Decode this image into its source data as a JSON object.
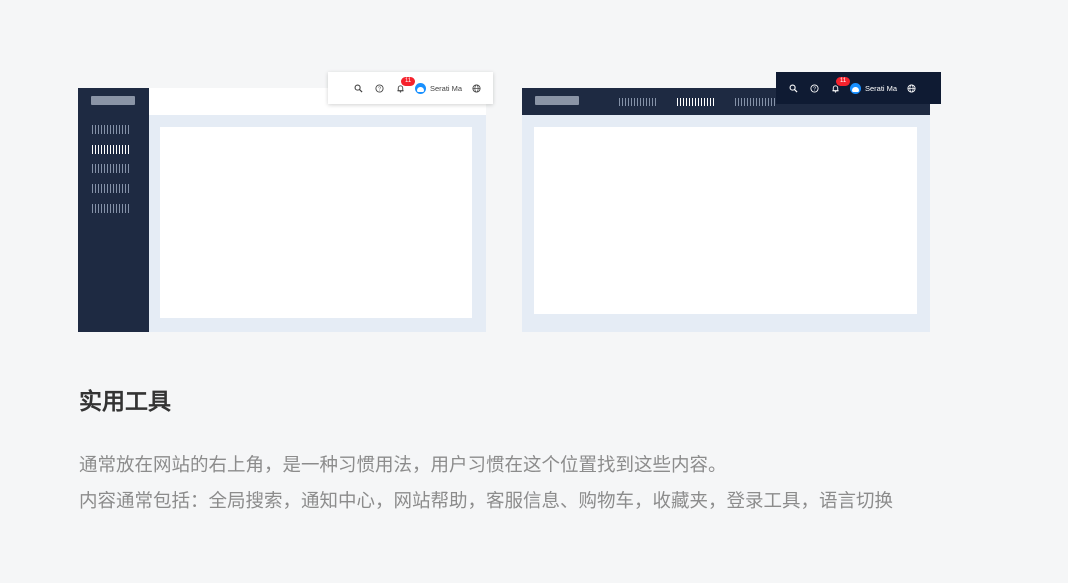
{
  "mockup_left": {
    "toolbar": {
      "icons": [
        "search-icon",
        "question-circle-icon",
        "bell-icon",
        "globe-icon"
      ],
      "badge_count": "11",
      "user_name": "Serati Ma"
    }
  },
  "mockup_right": {
    "toolbar": {
      "icons": [
        "search-icon",
        "question-circle-icon",
        "bell-icon",
        "globe-icon"
      ],
      "badge_count": "11",
      "user_name": "Serati Ma"
    }
  },
  "section": {
    "title": "实用工具",
    "description_line1": "通常放在网站的右上角，是一种习惯用法，用户习惯在这个位置找到这些内容。",
    "description_line2": "内容通常包括：全局搜索，通知中心，网站帮助，客服信息、购物车，收藏夹，登录工具，语言切换"
  },
  "colors": {
    "dark_nav": "#1e2a42",
    "dark_toolbar": "#0f1b33",
    "content_bg": "#e5ecf5",
    "badge": "#f5222d",
    "avatar": "#1890ff"
  }
}
